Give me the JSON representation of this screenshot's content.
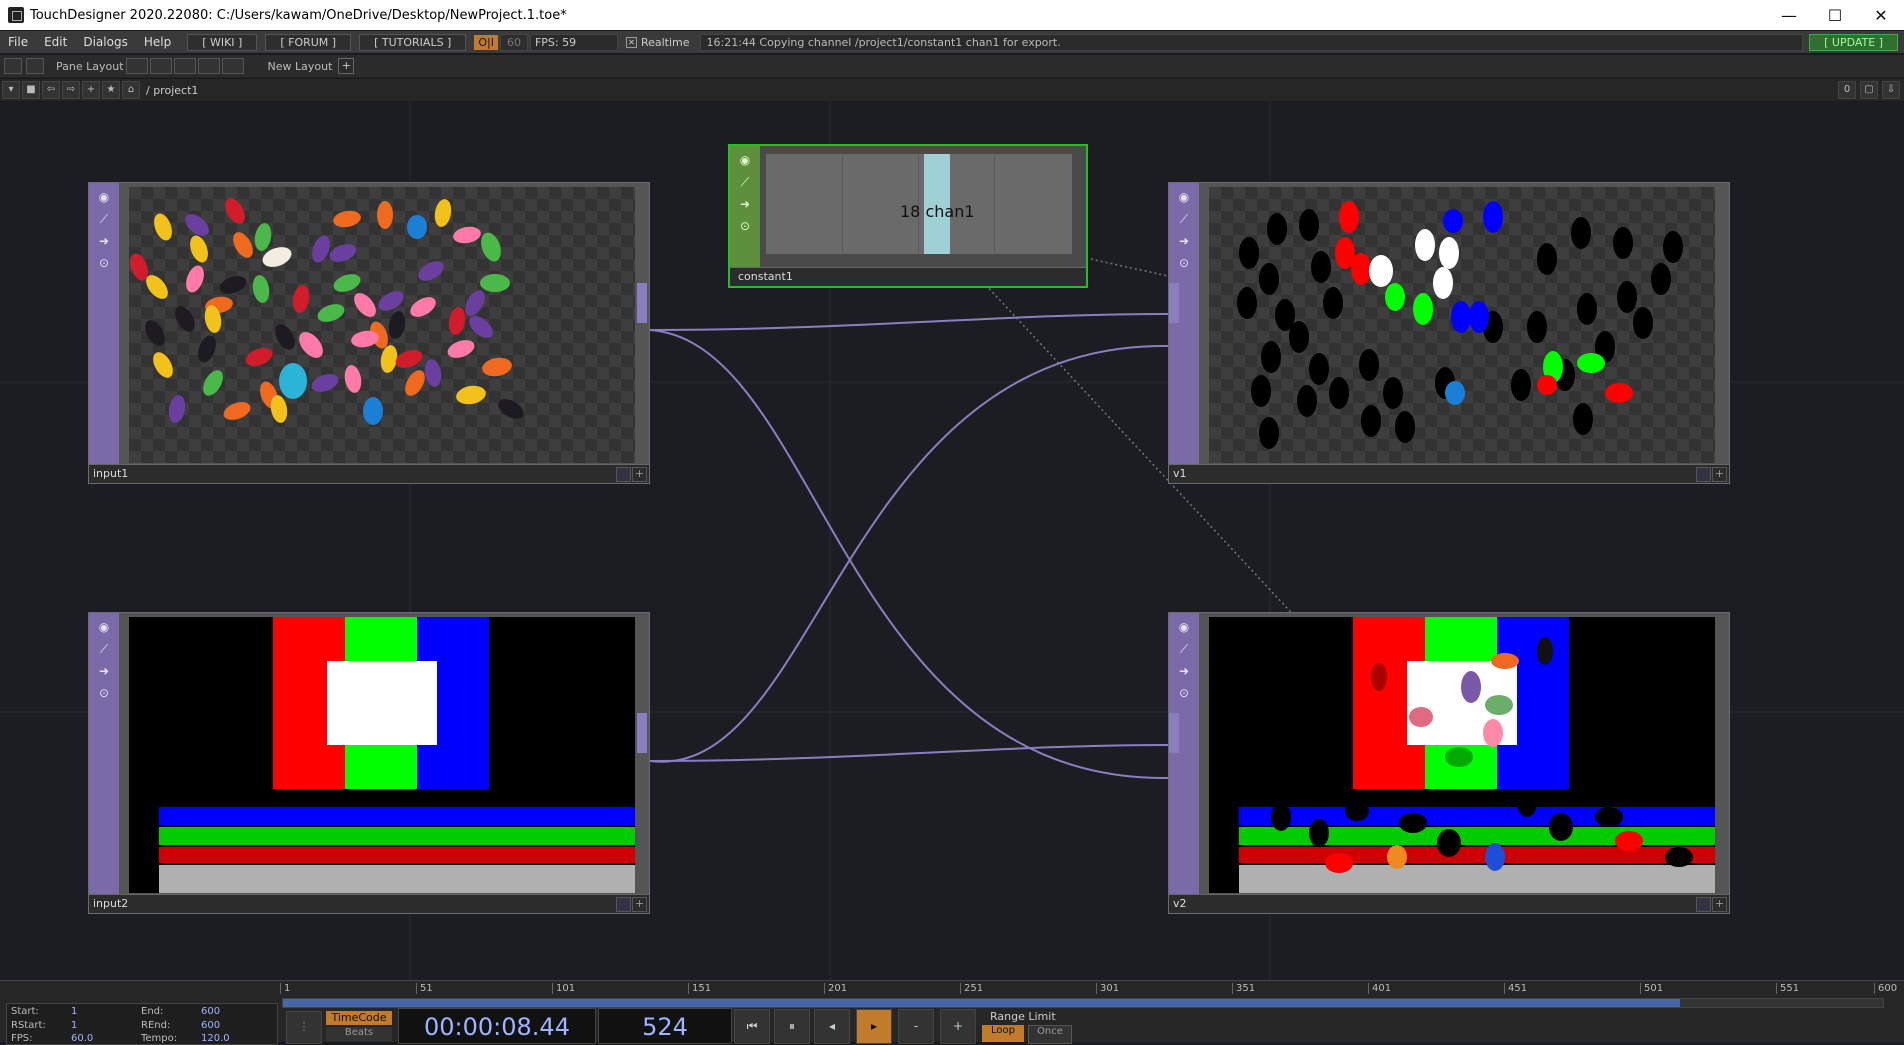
{
  "window": {
    "title": "TouchDesigner 2020.22080: C:/Users/kawam/OneDrive/Desktop/NewProject.1.toe*",
    "minimize": "—",
    "maximize": "☐",
    "close": "✕"
  },
  "menu": {
    "items": [
      "File",
      "Edit",
      "Dialogs",
      "Help"
    ],
    "wiki": "[ WIKI ]",
    "forum": "[ FORUM ]",
    "tutorials": "[ TUTORIALS ]",
    "oi": "O|I",
    "fps_cap": "60",
    "fps": "FPS:  59",
    "realtime": "Realtime",
    "status": "16:21:44 Copying channel /project1/constant1 chan1 for export.",
    "update": "[ UPDATE ]"
  },
  "toolbar": {
    "pane_layout": "Pane Layout",
    "new_layout": "New Layout",
    "plus": "+"
  },
  "pathbar": {
    "path": "/ project1",
    "counter": "0"
  },
  "nodes": {
    "input1": {
      "label": "input1"
    },
    "input2": {
      "label": "input2"
    },
    "v1": {
      "label": "v1"
    },
    "v2": {
      "label": "v2"
    },
    "constant1": {
      "label": "constant1",
      "channel": "18 chan1"
    }
  },
  "colors": {
    "accent": "#c27a2b",
    "top_node": "#7a6aa8",
    "chop_node": "#5d8f3d",
    "selected": "#22c022",
    "wire": "#8a7ec0",
    "timecode": "#9fb4ff"
  },
  "timeline": {
    "ticks": [
      "1",
      "51",
      "101",
      "151",
      "201",
      "251",
      "301",
      "351",
      "401",
      "451",
      "501",
      "551",
      "600"
    ],
    "progress": 0.873,
    "start_label": "Start:",
    "start": "1",
    "end_label": "End:",
    "end": "600",
    "rstart_label": "RStart:",
    "rstart": "1",
    "rend_label": "REnd:",
    "rend": "600",
    "fps_label": "FPS:",
    "fps": "60.0",
    "tempo_label": "Tempo:",
    "tempo": "120.0",
    "timecode_btn": "TimeCode",
    "beats_btn": "Beats",
    "timecode": "00:00:08.44",
    "frame": "524",
    "range_limit": "Range Limit",
    "loop": "Loop",
    "once": "Once"
  }
}
